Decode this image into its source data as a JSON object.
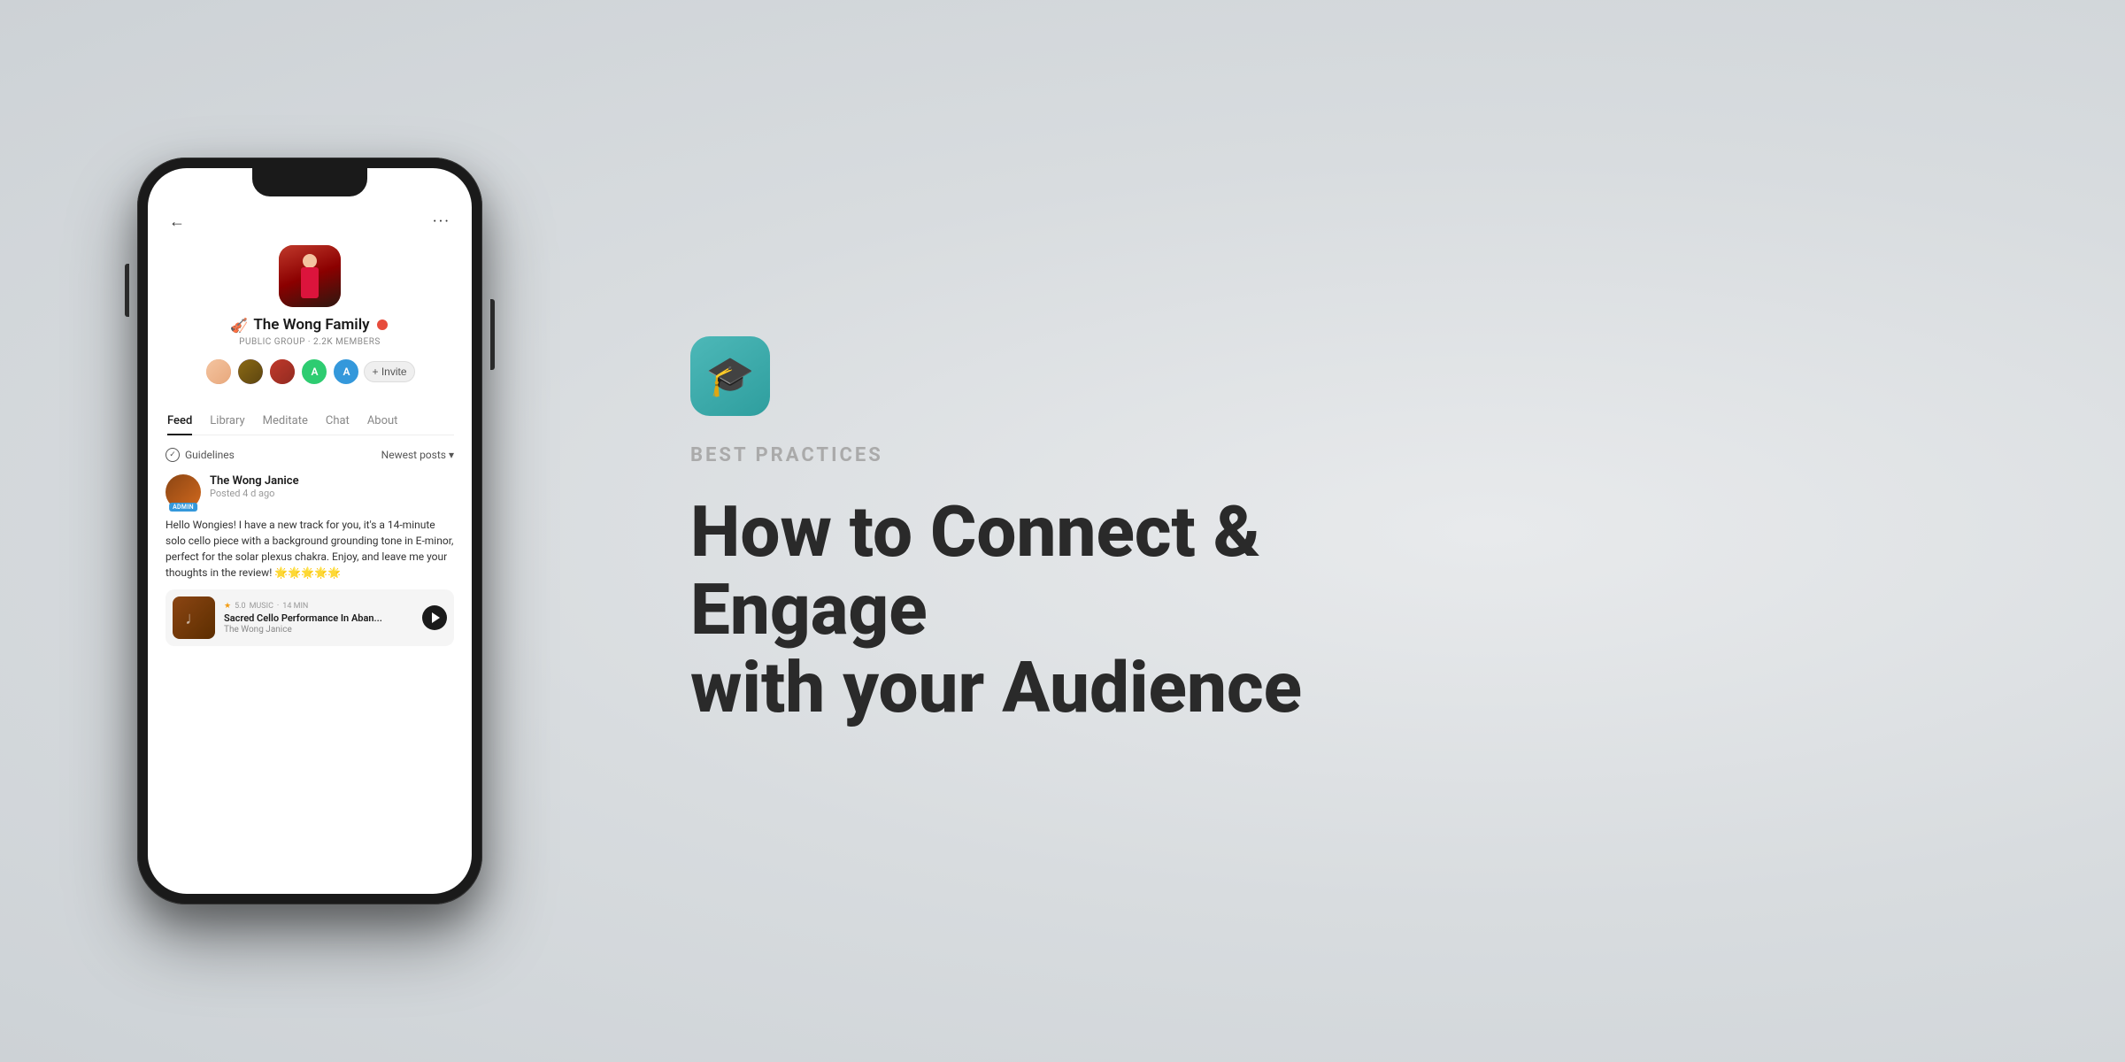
{
  "background": {
    "gradient": "radial-gradient(ellipse at 70% 50%, #e8eaec 0%, #d8dcdf 50%, #cdd2d6 100%)"
  },
  "phone": {
    "group": {
      "name_emoji": "🎻",
      "name_text": "The Wong Family",
      "badge_color": "#e74c3c",
      "meta": "PUBLIC GROUP · 2.2K MEMBERS",
      "members": [
        {
          "id": "1",
          "label": ""
        },
        {
          "id": "2",
          "label": ""
        },
        {
          "id": "3",
          "label": ""
        },
        {
          "id": "4",
          "label": "A"
        },
        {
          "id": "5",
          "label": "A"
        }
      ],
      "invite_label": "+ Invite"
    },
    "nav_tabs": [
      {
        "label": "Feed",
        "active": true
      },
      {
        "label": "Library",
        "active": false
      },
      {
        "label": "Meditate",
        "active": false
      },
      {
        "label": "Chat",
        "active": false
      },
      {
        "label": "About",
        "active": false
      }
    ],
    "guidelines": {
      "label": "Guidelines",
      "sort_label": "Newest posts",
      "sort_icon": "chevron-down"
    },
    "post": {
      "author": "The Wong Janice",
      "time": "Posted 4 d ago",
      "admin_badge": "ADMIN",
      "text": "Hello Wongies! I have a new track for you, it's a 14-minute solo cello piece with a background grounding tone in E-minor, perfect for the solar plexus chakra. Enjoy, and leave me your thoughts in the review! 🌟🌟🌟🌟🌟",
      "music_card": {
        "rating": "5.0",
        "category": "MUSIC",
        "duration": "14 MIN",
        "title": "Sacred Cello Performance In Aban...",
        "artist": "The Wong Janice"
      }
    }
  },
  "right": {
    "app_icon_emoji": "🎓",
    "best_practices_label": "BEST PRACTICES",
    "main_title_line1": "How to Connect & Engage",
    "main_title_line2": "with your Audience"
  }
}
